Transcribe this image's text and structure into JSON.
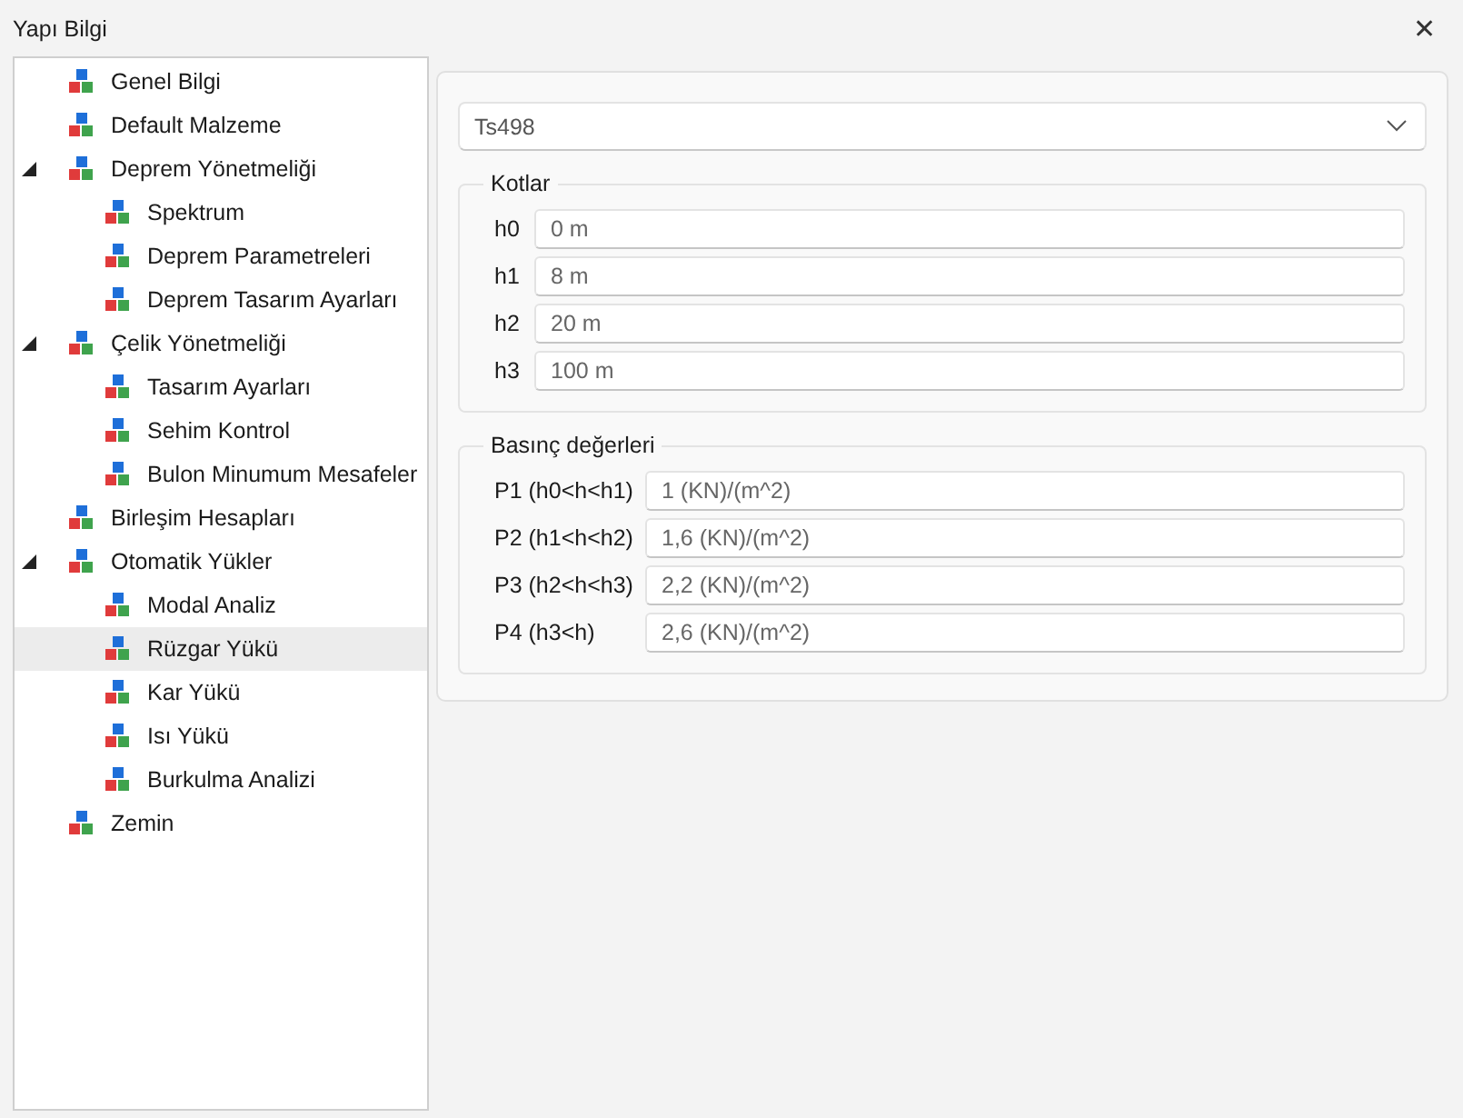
{
  "window": {
    "title": "Yapı Bilgi",
    "close": "✕"
  },
  "tree": [
    {
      "label": "Genel Bilgi",
      "selected": false
    },
    {
      "label": "Default Malzeme",
      "selected": false
    },
    {
      "label": "Deprem Yönetmeliği",
      "selected": false,
      "expanded": true,
      "children": [
        {
          "label": "Spektrum",
          "selected": false
        },
        {
          "label": "Deprem Parametreleri",
          "selected": false
        },
        {
          "label": "Deprem Tasarım Ayarları",
          "selected": false
        }
      ]
    },
    {
      "label": "Çelik Yönetmeliği",
      "selected": false,
      "expanded": true,
      "children": [
        {
          "label": "Tasarım Ayarları",
          "selected": false
        },
        {
          "label": "Sehim Kontrol",
          "selected": false
        },
        {
          "label": "Bulon Minumum Mesafeler",
          "selected": false
        }
      ]
    },
    {
      "label": "Birleşim Hesapları",
      "selected": false
    },
    {
      "label": "Otomatik Yükler",
      "selected": false,
      "expanded": true,
      "children": [
        {
          "label": "Modal Analiz",
          "selected": false
        },
        {
          "label": "Rüzgar Yükü",
          "selected": true
        },
        {
          "label": "Kar Yükü",
          "selected": false
        },
        {
          "label": "Isı Yükü",
          "selected": false
        },
        {
          "label": "Burkulma Analizi",
          "selected": false
        }
      ]
    },
    {
      "label": "Zemin",
      "selected": false
    }
  ],
  "standard": {
    "value": "Ts498"
  },
  "groups": [
    {
      "title": "Kotlar",
      "fields": [
        {
          "label": "h0",
          "value": "0 m"
        },
        {
          "label": "h1",
          "value": "8 m"
        },
        {
          "label": "h2",
          "value": "20 m"
        },
        {
          "label": "h3",
          "value": "100 m"
        }
      ]
    },
    {
      "title": "Basınç değerleri",
      "fields": [
        {
          "label": "P1 (h0<h<h1)",
          "value": "1 (KN)/(m^2)"
        },
        {
          "label": "P2 (h1<h<h2)",
          "value": "1,6 (KN)/(m^2)"
        },
        {
          "label": "P3 (h2<h<h3)",
          "value": "2,2 (KN)/(m^2)"
        },
        {
          "label": "P4 (h3<h)",
          "value": "2,6 (KN)/(m^2)"
        }
      ]
    }
  ]
}
